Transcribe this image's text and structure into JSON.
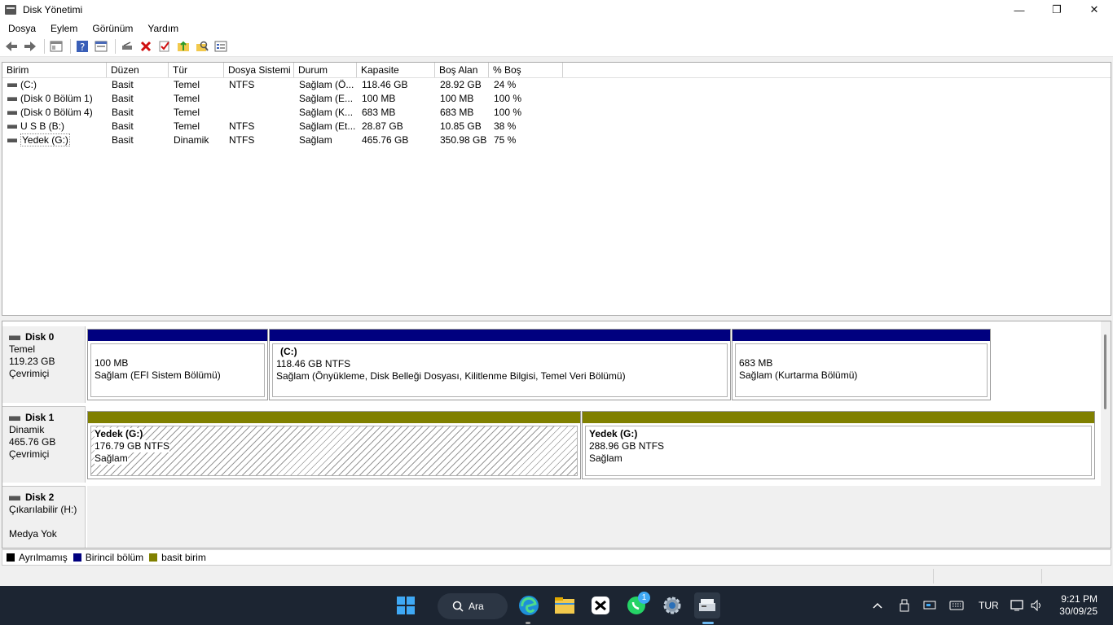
{
  "window": {
    "title": "Disk Yönetimi",
    "controls": [
      "—",
      "❐",
      "✕"
    ]
  },
  "menu": [
    "Dosya",
    "Eylem",
    "Görünüm",
    "Yardım"
  ],
  "volume_list": {
    "columns": [
      "Birim",
      "Düzen",
      "Tür",
      "Dosya Sistemi",
      "Durum",
      "Kapasite",
      "Boş Alan",
      "% Boş"
    ],
    "rows": [
      [
        "(C:)",
        "Basit",
        "Temel",
        "NTFS",
        "Sağlam (Ö...",
        "118.46 GB",
        "28.92 GB",
        "24 %"
      ],
      [
        "(Disk 0 Bölüm 1)",
        "Basit",
        "Temel",
        "",
        "Sağlam (E...",
        "100 MB",
        "100 MB",
        "100 %"
      ],
      [
        "(Disk 0 Bölüm 4)",
        "Basit",
        "Temel",
        "",
        "Sağlam (K...",
        "683 MB",
        "683 MB",
        "100 %"
      ],
      [
        "U S B (B:)",
        "Basit",
        "Temel",
        "NTFS",
        "Sağlam (Et...",
        "28.87 GB",
        "10.85 GB",
        "38 %"
      ],
      [
        "Yedek (G:)",
        "Basit",
        "Dinamik",
        "NTFS",
        "Sağlam",
        "465.76 GB",
        "350.98 GB",
        "75 %"
      ]
    ]
  },
  "disks": {
    "disk0": {
      "name": "Disk 0",
      "type": "Temel",
      "size": "119.23 GB",
      "status": "Çevrimiçi",
      "p1": {
        "line1": "100 MB",
        "line2": "Sağlam (EFI Sistem Bölümü)"
      },
      "p2": {
        "title": "(C:)",
        "line1": "118.46 GB NTFS",
        "line2": "Sağlam (Önyükleme, Disk Belleği Dosyası, Kilitlenme Bilgisi, Temel Veri Bölümü)"
      },
      "p3": {
        "line1": "683 MB",
        "line2": "Sağlam (Kurtarma Bölümü)"
      }
    },
    "disk1": {
      "name": "Disk 1",
      "type": "Dinamik",
      "size": "465.76 GB",
      "status": "Çevrimiçi",
      "p1": {
        "title": "Yedek  (G:)",
        "line1": "176.79 GB NTFS",
        "line2": "Sağlam"
      },
      "p2": {
        "title": "Yedek  (G:)",
        "line1": "288.96 GB NTFS",
        "line2": "Sağlam"
      }
    },
    "disk2": {
      "name": "Disk 2",
      "type": "Çıkarılabilir (H:)",
      "status": "Medya Yok"
    }
  },
  "legend": [
    {
      "label": "Ayrılmamış",
      "color": "#000000"
    },
    {
      "label": "Birincil bölüm",
      "color": "#00007f"
    },
    {
      "label": "basit birim",
      "color": "#808000"
    }
  ],
  "taskbar": {
    "search_label": "Ara",
    "whatsapp_badge": "1",
    "language": "TUR",
    "time": "9:21 PM",
    "date": "30/09/25"
  }
}
